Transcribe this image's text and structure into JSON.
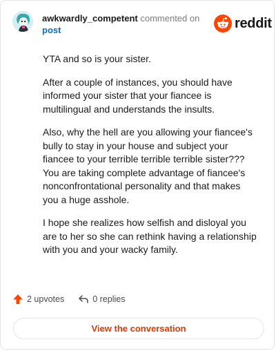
{
  "comment": {
    "username": "awkwardly_competent",
    "action_text": "commented on",
    "target_link": "post",
    "brand": "reddit",
    "paragraphs": [
      "YTA and so is your sister.",
      "After a couple of instances, you should have informed your sister that your fiancee is multilingual and understands the insults.",
      "Also, why the hell are you allowing your fiancee's bully to stay in your house and subject your fiancee to your terrible terrible terrible sister??? You are taking complete advantage of fiancee's nonconfrontational personality and that makes you a huge asshole.",
      "I hope she realizes how selfish and disloyal you are to her so she can rethink having a relationship with you and your wacky family."
    ]
  },
  "footer": {
    "upvotes": "2 upvotes",
    "replies": "0 replies",
    "cta_label": "View the conversation"
  },
  "colors": {
    "accent": "#d93a00",
    "upvote": "#ff4500",
    "link": "#0a6fc2"
  }
}
